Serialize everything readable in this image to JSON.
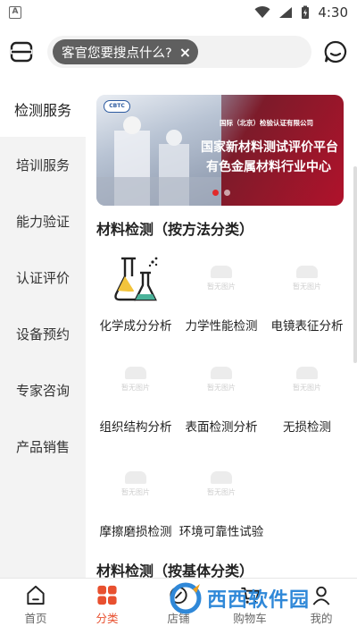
{
  "status_bar": {
    "time": "4:30",
    "left_icon": "A"
  },
  "search": {
    "placeholder_tag": "客官您要搜点什么?",
    "clear": "×"
  },
  "sidebar": {
    "items": [
      {
        "label": "检测服务",
        "active": true
      },
      {
        "label": "培训服务"
      },
      {
        "label": "能力验证"
      },
      {
        "label": "认证评价"
      },
      {
        "label": "设备预约"
      },
      {
        "label": "专家咨询"
      },
      {
        "label": "产品销售"
      }
    ]
  },
  "banner": {
    "logo": "CBTC",
    "org": "国际（北京）检验认证有限公司",
    "title1": "国家新材料测试评价平台",
    "title2": "有色金属材料行业中心"
  },
  "sections": [
    {
      "title": "材料检测（按方法分类）",
      "items": [
        {
          "label": "化学成分分析",
          "icon": "flask-icon"
        },
        {
          "label": "力学性能检测",
          "placeholder": "暂无图片"
        },
        {
          "label": "电镜表征分析",
          "placeholder": "暂无图片"
        },
        {
          "label": "组织结构分析",
          "placeholder": "暂无图片"
        },
        {
          "label": "表面检测分析",
          "placeholder": "暂无图片"
        },
        {
          "label": "无损检测",
          "placeholder": "暂无图片"
        },
        {
          "label": "摩擦磨损检测",
          "placeholder": "暂无图片"
        },
        {
          "label": "环境可靠性试验",
          "placeholder": "暂无图片"
        }
      ]
    },
    {
      "title": "材料检测（按基体分类）"
    }
  ],
  "bottom_nav": [
    {
      "label": "首页"
    },
    {
      "label": "分类",
      "active": true
    },
    {
      "label": "店铺"
    },
    {
      "label": "购物车"
    },
    {
      "label": "我的"
    }
  ],
  "watermark": {
    "text": "西西软件园"
  },
  "colors": {
    "accent": "#e8502f",
    "sidebar_bg": "#f3f3f3",
    "pill_bg": "#5f5f5f"
  }
}
